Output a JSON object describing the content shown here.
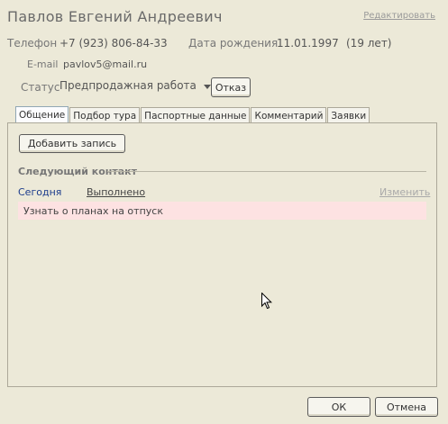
{
  "client": {
    "name": "Павлов Евгений Андреевич",
    "edit_label": "Редактировать"
  },
  "contact": {
    "phone_label": "Телефон",
    "phone_value": "+7 (923) 806-84-33",
    "birth_label": "Дата рождения",
    "birth_value": "11.01.1997",
    "age": "(19 лет)",
    "email_label": "E-mail",
    "email_value": "pavlov5@mail.ru"
  },
  "status": {
    "label": "Статус",
    "value": "Предпродажная работа",
    "reject_label": "Отказ"
  },
  "tabs": [
    {
      "label": "Общение",
      "active": true
    },
    {
      "label": "Подбор тура"
    },
    {
      "label": "Паспортные данные"
    },
    {
      "label": "Комментарий"
    },
    {
      "label": "Заявки"
    }
  ],
  "panel": {
    "add_record_label": "Добавить запись",
    "next_contact_title": "Следующий контакт",
    "when": "Сегодня",
    "done_label": "Выполнено",
    "change_label": "Изменить",
    "task_text": "Узнать о планах на отпуск"
  },
  "footer": {
    "ok_label": "ОК",
    "cancel_label": "Отмена"
  }
}
